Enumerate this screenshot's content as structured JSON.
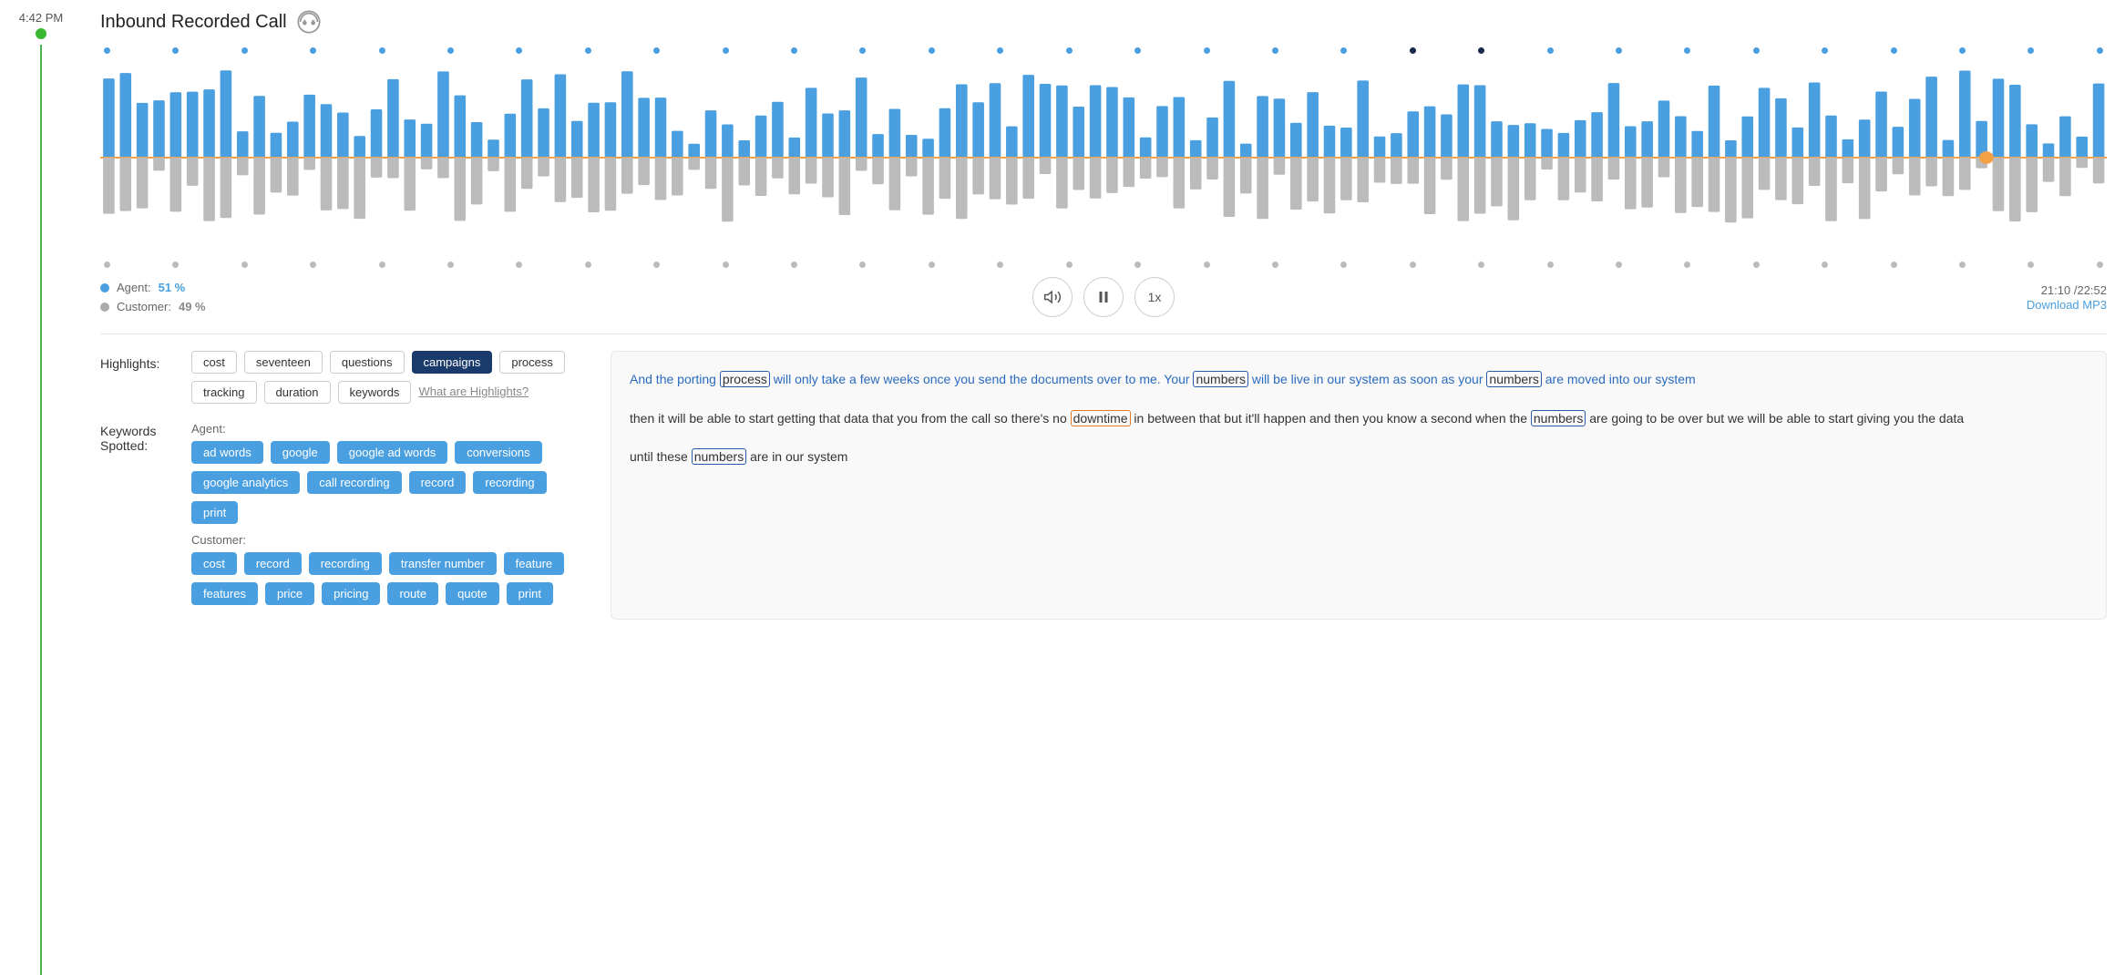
{
  "header": {
    "time": "4:42 PM",
    "title": "Inbound Recorded Call"
  },
  "waveform": {
    "agent_label": "Agent:",
    "agent_percent": "51 %",
    "customer_label": "Customer:",
    "customer_percent": "49 %",
    "current_time": "21:10",
    "total_time": "22:52",
    "time_display": "21:10 /22:52",
    "download_label": "Download MP3",
    "speed_label": "1x",
    "progress_pct": 94
  },
  "highlights": {
    "section_label": "Highlights:",
    "tags": [
      {
        "label": "cost",
        "active": false
      },
      {
        "label": "seventeen",
        "active": false
      },
      {
        "label": "questions",
        "active": false
      },
      {
        "label": "campaigns",
        "active": true
      },
      {
        "label": "process",
        "active": false
      },
      {
        "label": "tracking",
        "active": false
      },
      {
        "label": "duration",
        "active": false
      },
      {
        "label": "keywords",
        "active": false
      }
    ],
    "what_are_highlights": "What are Highlights?"
  },
  "keywords": {
    "section_label": "Keywords\nSpotted:",
    "agent_label": "Agent:",
    "agent_tags": [
      "ad words",
      "google",
      "google ad words",
      "conversions",
      "google analytics",
      "call recording",
      "record",
      "recording",
      "print"
    ],
    "customer_label": "Customer:",
    "customer_tags": [
      "cost",
      "record",
      "recording",
      "transfer number",
      "feature",
      "features",
      "price",
      "pricing",
      "route",
      "quote",
      "print"
    ]
  },
  "transcript": {
    "para1": "And the porting process will only take a few weeks once you send the documents over to me. Your numbers will be live in our system as soon as your numbers are moved into our system",
    "para1_highlights": [
      "process",
      "numbers",
      "numbers"
    ],
    "para2_prefix": "then it will be able to start getting that data that you from the call so there's no ",
    "para2_highlight": "downtime",
    "para2_suffix": " in between that but it'll happen and then you know a second when the ",
    "para2_highlight2": "numbers",
    "para2_suffix2": " are going to be over but we will be able to start giving you the data",
    "para3_suffix": "until these numbers are in our system"
  }
}
